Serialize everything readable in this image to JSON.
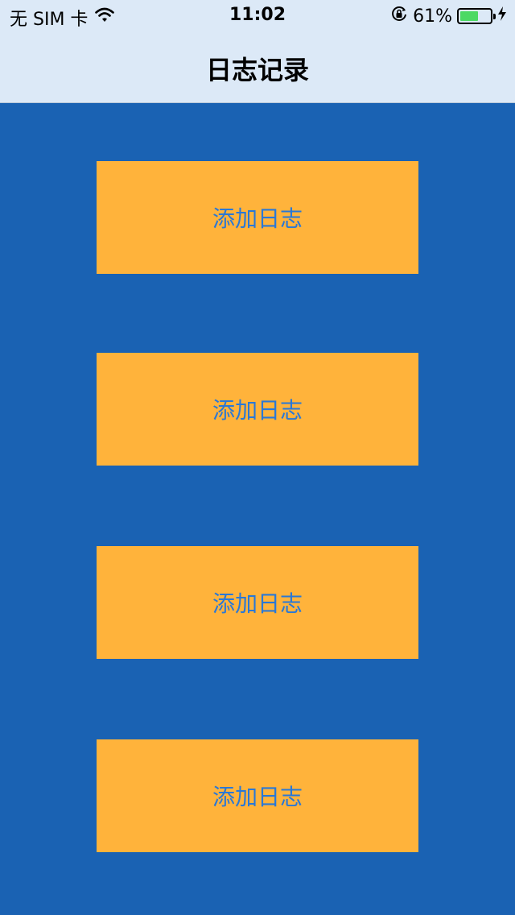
{
  "status_bar": {
    "carrier": "无 SIM 卡",
    "time": "11:02",
    "battery_percent": "61%",
    "battery_level": 0.61,
    "battery_color": "#4cd964"
  },
  "nav": {
    "title": "日志记录"
  },
  "buttons": [
    {
      "label": "添加日志"
    },
    {
      "label": "添加日志"
    },
    {
      "label": "添加日志"
    },
    {
      "label": "添加日志"
    }
  ],
  "colors": {
    "background": "#1a62b3",
    "navbar": "#dce9f7",
    "button_bg": "#ffb33b",
    "button_text": "#2a78d6"
  }
}
